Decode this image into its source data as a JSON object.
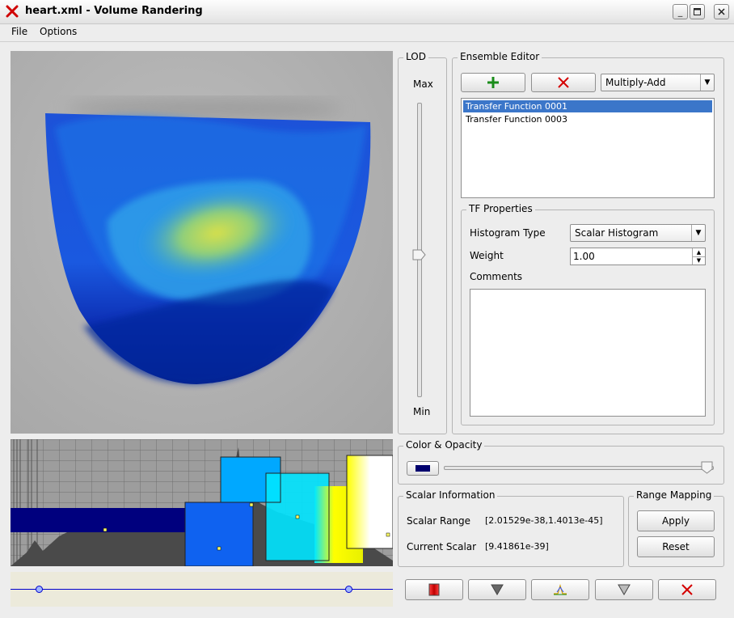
{
  "window": {
    "title": "heart.xml - Volume Randering",
    "app_icon": "x-logo-icon",
    "controls": [
      "minimize-icon",
      "maximize-icon",
      "close-icon"
    ]
  },
  "menu": [
    {
      "label": "File",
      "mnemonic": "F"
    },
    {
      "label": "Options",
      "mnemonic": "O"
    }
  ],
  "lod": {
    "title": "LOD",
    "max_label": "Max",
    "min_label": "Min",
    "level": 0.51
  },
  "ensemble": {
    "title": "Ensemble Editor",
    "add_icon": "plus-icon",
    "remove_icon": "x-icon",
    "blend_mode": "Multiply-Add",
    "items": [
      {
        "label": "Transfer Function 0001",
        "selected": true
      },
      {
        "label": "Transfer Function 0003",
        "selected": false
      }
    ]
  },
  "tf_properties": {
    "title": "TF Properties",
    "histogram_type_label": "Histogram Type",
    "histogram_type_value": "Scalar Histogram",
    "weight_label": "Weight",
    "weight_value": "1.00",
    "comments_label": "Comments",
    "comments_value": ""
  },
  "color_opacity": {
    "title": "Color & Opacity",
    "swatch_color": "#00006e",
    "opacity": 0.95
  },
  "scalar_info": {
    "title": "Scalar Information",
    "range_label": "Scalar Range",
    "range_value": "[2.01529e-38,1.4013e-45]",
    "current_label": "Current Scalar",
    "current_value": "[9.41861e-39]"
  },
  "range_mapping": {
    "title": "Range Mapping",
    "apply_label": "Apply",
    "reset_label": "Reset"
  },
  "toolbar_icons": [
    "color-ramp-icon",
    "triangle-down-icon",
    "peak-icon",
    "triangle-down-outline-icon",
    "delete-icon"
  ],
  "colors": {
    "selection": "#3b76c9",
    "add_green": "#1a8c1a",
    "remove_red": "#d40000",
    "range_line": "#0000cc"
  }
}
